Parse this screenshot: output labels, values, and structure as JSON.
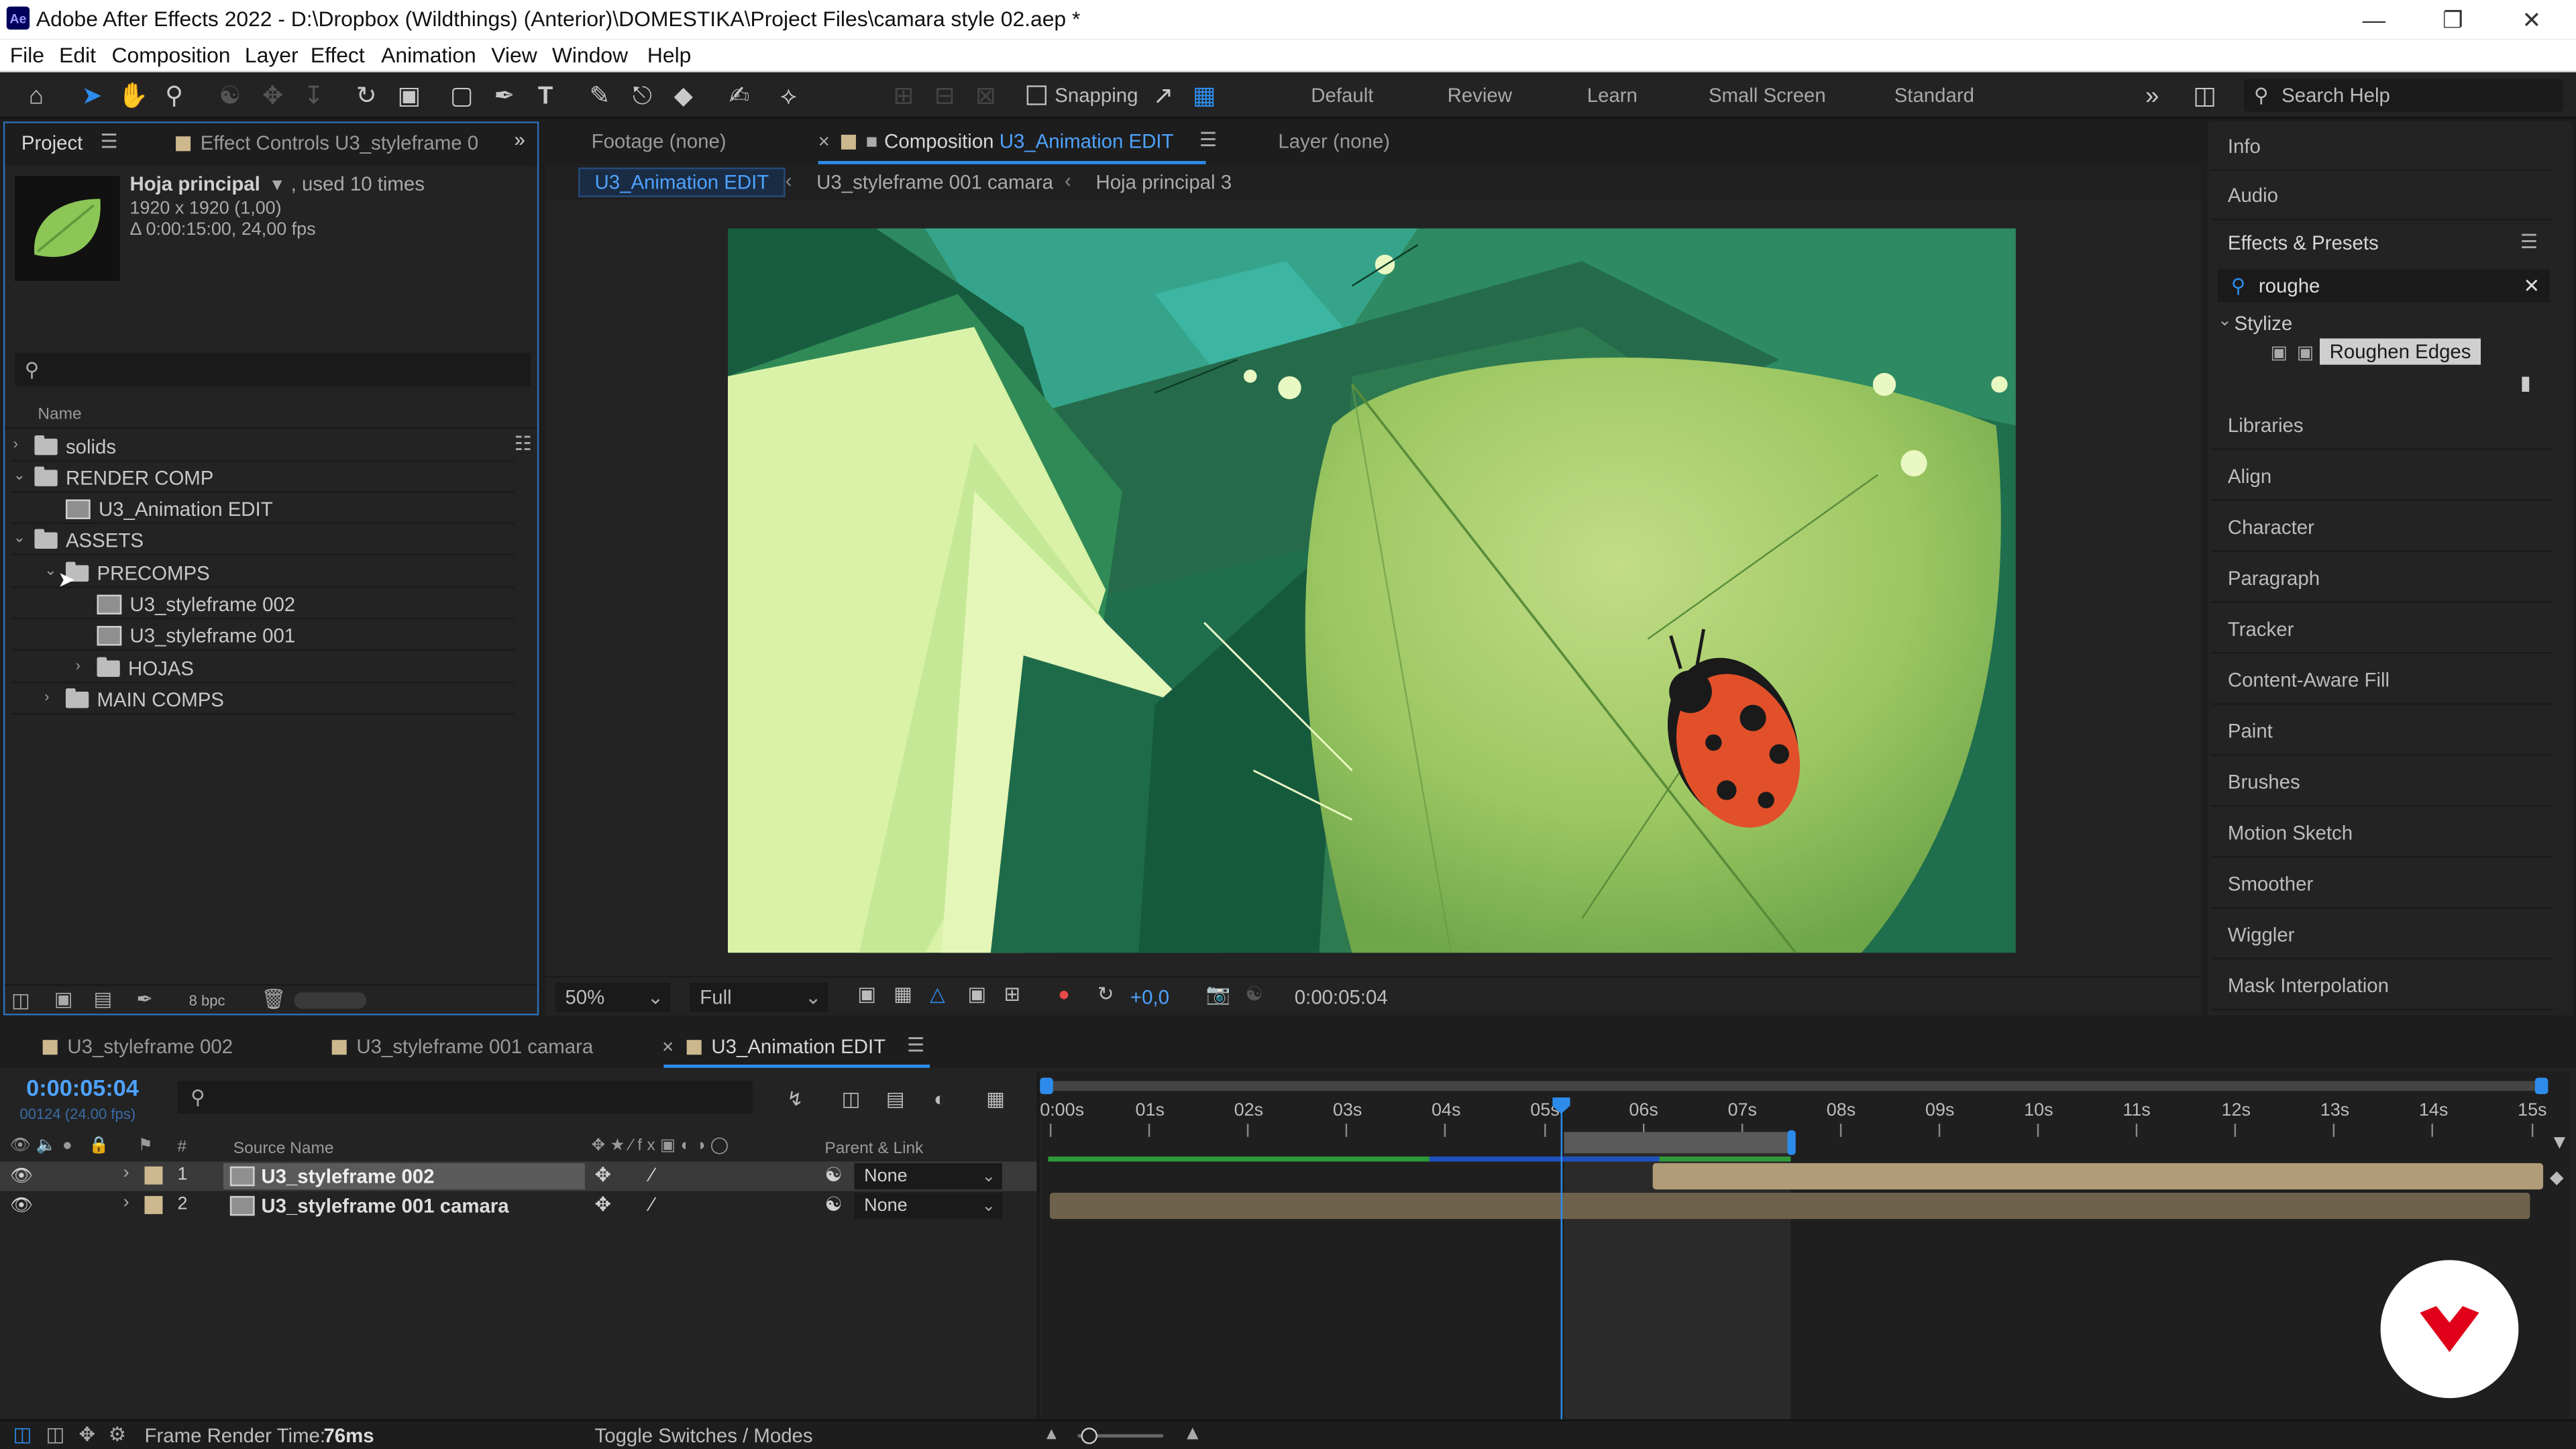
{
  "window": {
    "title": "Adobe After Effects 2022 - D:\\Dropbox (Wildthings) (Anterior)\\DOMESTIKA\\Project Files\\camara style 02.aep *",
    "app_icon": "Ae"
  },
  "menu": [
    "File",
    "Edit",
    "Composition",
    "Layer",
    "Effect",
    "Animation",
    "View",
    "Window",
    "Help"
  ],
  "toolbar": {
    "snapping_label": "Snapping",
    "workspaces": [
      "Default",
      "Review",
      "Learn",
      "Small Screen",
      "Standard"
    ],
    "search_placeholder": "Search Help"
  },
  "project_panel": {
    "tab_project": "Project",
    "tab_effect_controls": "Effect Controls U3_styleframe 0",
    "selected_name": "Hoja principal",
    "used_text": ", used 10 times",
    "dimensions": "1920 x 1920 (1,00)",
    "duration": "Δ 0:00:15:00, 24,00 fps",
    "search_placeholder": "",
    "column_name": "Name",
    "bpc": "8 bpc",
    "tree": [
      {
        "label": "solids",
        "type": "folder",
        "indent": 0,
        "expanded": false
      },
      {
        "label": "RENDER COMP",
        "type": "folder",
        "indent": 0,
        "expanded": true
      },
      {
        "label": "U3_Animation EDIT",
        "type": "comp",
        "indent": 1
      },
      {
        "label": "ASSETS",
        "type": "folder",
        "indent": 0,
        "expanded": true
      },
      {
        "label": "PRECOMPS",
        "type": "folder",
        "indent": 1,
        "expanded": true
      },
      {
        "label": "U3_styleframe 002",
        "type": "comp",
        "indent": 2
      },
      {
        "label": "U3_styleframe 001",
        "type": "comp",
        "indent": 2
      },
      {
        "label": "HOJAS",
        "type": "folder",
        "indent": 2,
        "expanded": false
      },
      {
        "label": "MAIN COMPS",
        "type": "folder",
        "indent": 1,
        "expanded": false
      }
    ]
  },
  "viewer": {
    "tab_footage": "Footage  (none)",
    "tab_composition_prefix": "Composition",
    "tab_composition_name": "U3_Animation EDIT",
    "tab_layer": "Layer  (none)",
    "breadcrumbs": [
      "U3_Animation EDIT",
      "U3_styleframe 001 camara",
      "Hoja principal 3"
    ],
    "zoom": "50%",
    "resolution": "Full",
    "exposure": "+0,0",
    "timecode": "0:00:05:04"
  },
  "right_panel": {
    "info": "Info",
    "audio": "Audio",
    "effects_presets": "Effects & Presets",
    "search_value": "roughe",
    "category": "Stylize",
    "effect": "Roughen Edges",
    "items": [
      "Libraries",
      "Align",
      "Character",
      "Paragraph",
      "Tracker",
      "Content-Aware Fill",
      "Paint",
      "Brushes",
      "Motion Sketch",
      "Smoother",
      "Wiggler",
      "Mask Interpolation"
    ]
  },
  "timeline": {
    "tabs": [
      "U3_styleframe 002",
      "U3_styleframe 001 camara",
      "U3_Animation EDIT"
    ],
    "timecode": "0:00:05:04",
    "frame_info": "00124 (24.00 fps)",
    "col_source_name": "Source Name",
    "col_parent": "Parent & Link",
    "ruler": [
      "0:00s",
      "01s",
      "02s",
      "03s",
      "04s",
      "05s",
      "06s",
      "07s",
      "08s",
      "09s",
      "10s",
      "11s",
      "12s",
      "13s",
      "14s",
      "15s"
    ],
    "playhead_seconds": 5.17,
    "work_area_end_seconds": 7.5,
    "layers": [
      {
        "num": "1",
        "name": "U3_styleframe 002",
        "parent": "None",
        "start_seconds": 6.1
      },
      {
        "num": "2",
        "name": "U3_styleframe 001 camara",
        "parent": "None",
        "start_seconds": 0
      }
    ],
    "frame_render_label": "Frame Render Time:",
    "frame_render_value": "76ms",
    "toggle_label": "Toggle Switches / Modes"
  },
  "colors": {
    "accent_blue": "#2d8ceb",
    "layer_bar": "#b19c7a",
    "label_tan": "#cdb88e",
    "ladybug_red": "#e2502a"
  }
}
